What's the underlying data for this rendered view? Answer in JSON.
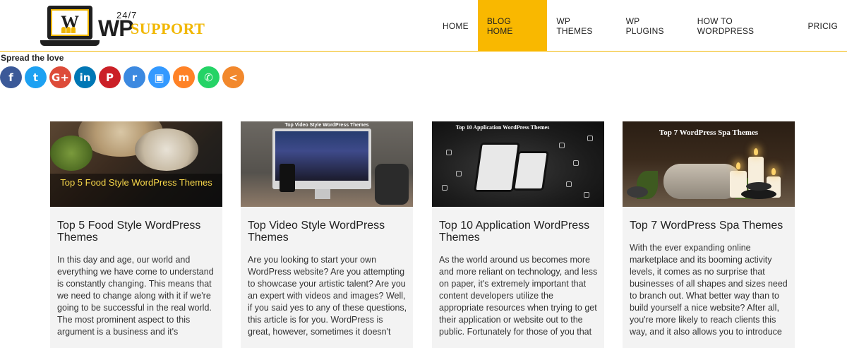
{
  "logo": {
    "letter": "W",
    "top_text": "24/7",
    "wp_text": "WP",
    "support_text": "SUPPORT"
  },
  "nav": {
    "items": [
      {
        "label": "HOME",
        "active": false
      },
      {
        "label": "BLOG HOME",
        "active": true
      },
      {
        "label": "WP THEMES",
        "active": false
      },
      {
        "label": "WP PLUGINS",
        "active": false
      },
      {
        "label": "HOW TO WORDPRESS",
        "active": false
      },
      {
        "label": "PRICIG",
        "active": false
      }
    ]
  },
  "share": {
    "heading": "Spread the love",
    "buttons": [
      {
        "name": "facebook",
        "glyph": "f",
        "color": "#3b5998"
      },
      {
        "name": "twitter",
        "glyph": "t",
        "color": "#1da1f2"
      },
      {
        "name": "google-plus",
        "glyph": "G+",
        "color": "#dd4b39"
      },
      {
        "name": "linkedin",
        "glyph": "in",
        "color": "#0077b5"
      },
      {
        "name": "pinterest",
        "glyph": "P",
        "color": "#cb2027"
      },
      {
        "name": "reddit",
        "glyph": "r",
        "color": "#3c89e0"
      },
      {
        "name": "delicious",
        "glyph": "▣",
        "color": "#3399ff"
      },
      {
        "name": "mix",
        "glyph": "m",
        "color": "#ff8226"
      },
      {
        "name": "whatsapp",
        "glyph": "✆",
        "color": "#25d366"
      },
      {
        "name": "more-share",
        "glyph": "<",
        "color": "#f2882c"
      }
    ]
  },
  "cards": [
    {
      "image_caption": "Top 5 Food Style WordPress Themes",
      "title": "Top 5 Food Style WordPress Themes",
      "excerpt": "In this day and age, our world and everything we have come to understand is constantly changing. This means that we need to change along with it if we're going to be successful in the real world. The most prominent aspect to this argument is a business and it's"
    },
    {
      "image_caption": "Top Video Style WordPress Themes",
      "title": "Top Video Style WordPress Themes",
      "excerpt": "Are you looking to start your own WordPress website? Are you attempting to showcase your artistic talent? Are you an expert with videos and images? Well, if you said yes to any of these questions, this article is for you. WordPress is great, however, sometimes it doesn't"
    },
    {
      "image_caption": "Top 10 Application WordPress Themes",
      "title": "Top 10 Application WordPress Themes",
      "excerpt": "As the world around us becomes more and more reliant on technology, and less on paper, it's extremely important that content developers utilize the appropriate resources when trying to get their application or website out to the public. Fortunately for those of you that"
    },
    {
      "image_caption": "Top 7 WordPress Spa Themes",
      "title": "Top 7 WordPress Spa Themes",
      "excerpt": "With the ever expanding online marketplace and its booming activity levels, it comes as no surprise that businesses of all shapes and sizes need to branch out. What better way than to build yourself a nice website? After all, you're more likely to reach clients this way, and it also allows you to introduce"
    }
  ]
}
